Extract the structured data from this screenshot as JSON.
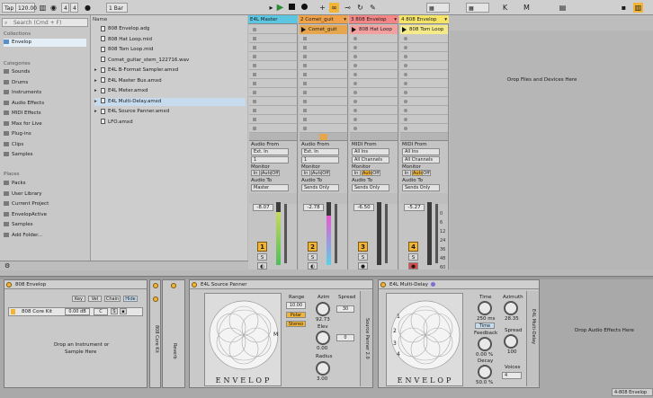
{
  "topbar": {
    "tap": "Tap",
    "tempo": "120.00",
    "sig_num": "4",
    "sig_den": "4",
    "quantize": "1 Bar",
    "left_icons": [
      "metronome-icon",
      "sync-icon"
    ]
  },
  "browser": {
    "search_placeholder": "Search (Cmd + F)",
    "collections_header": "Collections",
    "collections": [
      {
        "label": "Envelop",
        "selected": true
      }
    ],
    "categories_header": "Categories",
    "categories": [
      {
        "label": "Sounds"
      },
      {
        "label": "Drums"
      },
      {
        "label": "Instruments"
      },
      {
        "label": "Audio Effects"
      },
      {
        "label": "MIDI Effects"
      },
      {
        "label": "Max for Live"
      },
      {
        "label": "Plug-ins"
      },
      {
        "label": "Clips"
      },
      {
        "label": "Samples"
      }
    ],
    "places_header": "Places",
    "places": [
      {
        "label": "Packs"
      },
      {
        "label": "User Library"
      },
      {
        "label": "Current Project"
      },
      {
        "label": "EnvelopActive"
      },
      {
        "label": "Samples"
      },
      {
        "label": "Add Folder..."
      }
    ],
    "name_header": "Name",
    "files": [
      {
        "label": "808 Envelop.adg",
        "folder": false,
        "selected": false
      },
      {
        "label": "808 Hat Loop.mid",
        "folder": false,
        "selected": false
      },
      {
        "label": "808 Tom Loop.mid",
        "folder": false,
        "selected": false
      },
      {
        "label": "Comet_guitar_stem_122716.wav",
        "folder": false,
        "selected": false
      },
      {
        "label": "E4L B-Format Sampler.amxd",
        "folder": true,
        "selected": false
      },
      {
        "label": "E4L Master Bus.amxd",
        "folder": true,
        "selected": false
      },
      {
        "label": "E4L Meter.amxd",
        "folder": true,
        "selected": false
      },
      {
        "label": "E4L Multi-Delay.amxd",
        "folder": true,
        "selected": true
      },
      {
        "label": "E4L Source Panner.amxd",
        "folder": true,
        "selected": false
      },
      {
        "label": "LFO.amxd",
        "folder": false,
        "selected": false
      }
    ]
  },
  "session": {
    "drop_hint": "Drop Files and Devices Here",
    "tracks": [
      {
        "name": "E4L Master",
        "color": "#5cc6e0",
        "clip": "",
        "clip_color": "",
        "io_from_label": "Audio From",
        "from": "Ext. In",
        "from_ch": "1",
        "monitor_label": "Monitor",
        "monitor": [
          "In",
          "Auto",
          "Off"
        ],
        "to_label": "Audio To",
        "to": "Master",
        "volume": "-8.07",
        "number": "1",
        "meter_level": 0.85,
        "meter_color": "green"
      },
      {
        "name": "2 Comet_guit",
        "color": "#f0a24a",
        "clip": "Comet_guit",
        "clip_color": "#e5a64d",
        "io_from_label": "Audio From",
        "from": "Ext. In",
        "from_ch": "1",
        "monitor_label": "Monitor",
        "monitor": [
          "In",
          "Auto",
          "Off"
        ],
        "to_label": "Audio To",
        "to": "Sends Only",
        "volume": "-2.78",
        "number": "2",
        "meter_level": 0.78,
        "meter_color": "magenta"
      },
      {
        "name": "3 808 Envelop",
        "color": "#f28686",
        "clip": "808 Hat Loop",
        "clip_color": "#f2a0a0",
        "io_from_label": "MIDI From",
        "from": "All Ins",
        "from_ch": "All Channels",
        "monitor_label": "Monitor",
        "monitor": [
          "In",
          "Auto",
          "Off"
        ],
        "to_label": "Audio To",
        "to": "Sends Only",
        "volume": "-6.50",
        "number": "3",
        "meter_level": 0.0,
        "meter_color": "green"
      },
      {
        "name": "4 808 Envelop",
        "color": "#f4e46a",
        "clip": "808 Tom Loop",
        "clip_color": "#f4ea8a",
        "io_from_label": "MIDI From",
        "from": "All Ins",
        "from_ch": "All Channels",
        "monitor_label": "Monitor",
        "monitor": [
          "In",
          "Auto",
          "Off"
        ],
        "to_label": "Audio To",
        "to": "Sends Only",
        "volume": "-5.27",
        "number": "4",
        "meter_level": 0.0,
        "meter_color": "green"
      }
    ],
    "db_ticks": [
      "0",
      "6",
      "12",
      "24",
      "36",
      "48",
      "60"
    ]
  },
  "devices": {
    "envelop_rack": {
      "title": "808 Envelop",
      "buttons": [
        "Key",
        "Vel",
        "Chain",
        "Hide"
      ],
      "chain_name": "808 Core Kit",
      "chain_vol": "0.00 dB",
      "chain_pan": "C",
      "drop_hint_1": "Drop an Instrument or",
      "drop_hint_2": "Sample Here",
      "vertical_label": "808 Core Kit",
      "returns_label": "Reverb"
    },
    "source_panner": {
      "title": "E4L Source Panner",
      "brand": "ENVELOP",
      "side_label": "Source Panner 2.0",
      "range_label": "Range",
      "range_value": "10.00",
      "polar_label": "Polar",
      "stereo_label": "Stereo",
      "azim_label": "Azim",
      "azim_value": "92.73",
      "elev_label": "Elev",
      "elev_value": "0.00",
      "spread_label": "Spread",
      "spread_value": "30",
      "spread2_value": "0",
      "radius_label": "Radius",
      "radius_value": "3.00",
      "marker": "M"
    },
    "multi_delay": {
      "title": "E4L Multi-Delay",
      "brand": "ENVELOP",
      "side_label": "E4L Multi-Delay",
      "time_label": "Time",
      "time_value": "250 ms",
      "time_mode": "Time",
      "feedback_label": "Feedback",
      "feedback_value": "0.00 %",
      "decay_label": "Decay",
      "decay_value": "50.0 %",
      "azimuth_label": "Azimuth",
      "azimuth_value": "28.35",
      "spread_label": "Spread",
      "spread_value": "100",
      "voices_label": "Voices",
      "voices_value": "4",
      "markers": [
        "1",
        "2",
        "3",
        "4"
      ]
    },
    "drop_effects_hint": "Drop Audio Effects Here"
  },
  "statusbar": {
    "right_label": "4-808 Envelop"
  },
  "colors": {
    "accent": "#f2b437",
    "selection": "#c6dbee"
  }
}
